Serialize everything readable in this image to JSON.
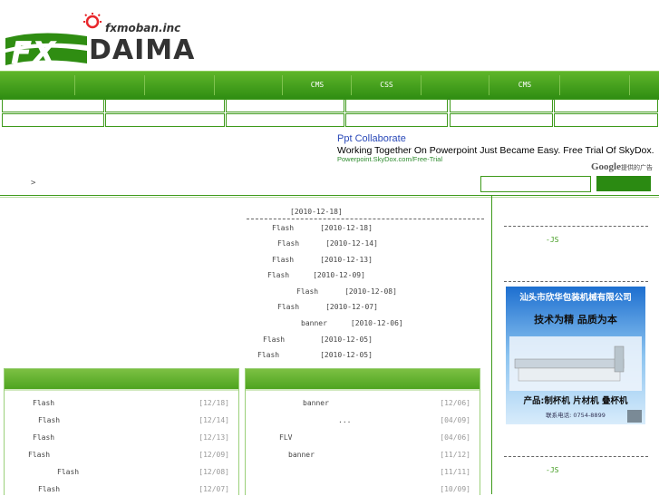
{
  "brand": {
    "tagline": "fxmoban.inc",
    "logo_text": "DAIMA",
    "logo_fx": "FX"
  },
  "nav": {
    "items": [
      "",
      "",
      "",
      "",
      "CMS",
      "CSS",
      "",
      "CMS",
      "",
      ""
    ]
  },
  "ad": {
    "title": "Ppt Collaborate",
    "body": "Working Together On Powerpoint Just Became Easy. Free Trial Of SkyDox.",
    "url": "Powerpoint.SkyDox.com/Free-Trial",
    "google_label": "提供的广告",
    "google_word": "Google"
  },
  "breadcrumb": ">",
  "search": {
    "placeholder": ""
  },
  "latest": {
    "date": "[2010-12-18]",
    "rows": [
      {
        "title": "Flash",
        "date": "[2010-12-18]"
      },
      {
        "title": "Flash",
        "date": "[2010-12-14]"
      },
      {
        "title": "Flash",
        "date": "[2010-12-13]"
      },
      {
        "title": "Flash",
        "date": "[2010-12-09]"
      },
      {
        "title": "Flash",
        "date": "[2010-12-08]"
      },
      {
        "title": "Flash",
        "date": "[2010-12-07]"
      },
      {
        "title": "banner",
        "date": "[2010-12-06]"
      },
      {
        "title": "Flash",
        "date": "[2010-12-05]"
      },
      {
        "title": "Flash",
        "date": "[2010-12-05]"
      }
    ]
  },
  "sidebar": {
    "js_label_1": "-JS",
    "js_label_2": "-JS",
    "ad_image": {
      "company": "汕头市欣华包装机械有限公司",
      "slogan": "技术为精 品质为本",
      "products": "产品:制杯机 片材机 叠杯机",
      "phone": "联系电话: 0754-8899"
    }
  },
  "box_left": {
    "items": [
      {
        "title": "Flash",
        "date": "[12/18]"
      },
      {
        "title": "Flash",
        "date": "[12/14]"
      },
      {
        "title": "Flash",
        "date": "[12/13]"
      },
      {
        "title": "Flash",
        "date": "[12/09]"
      },
      {
        "title": "Flash",
        "date": "[12/08]"
      },
      {
        "title": "Flash",
        "date": "[12/07]"
      }
    ]
  },
  "box_right": {
    "items": [
      {
        "title": "banner",
        "date": "[12/06]"
      },
      {
        "title": "...",
        "date": "[04/09]"
      },
      {
        "title": "FLV",
        "date": "[04/06]"
      },
      {
        "title": "banner",
        "date": "[11/12]"
      },
      {
        "title": "",
        "date": "[11/11]"
      },
      {
        "title": "",
        "date": "[10/09]"
      }
    ]
  },
  "colors": {
    "accent": "#3e9a1b",
    "nav_top": "#5fb52a",
    "nav_bottom": "#2f8d12",
    "ad_title": "#2a49b8",
    "ad_url": "#2e8b2e"
  }
}
